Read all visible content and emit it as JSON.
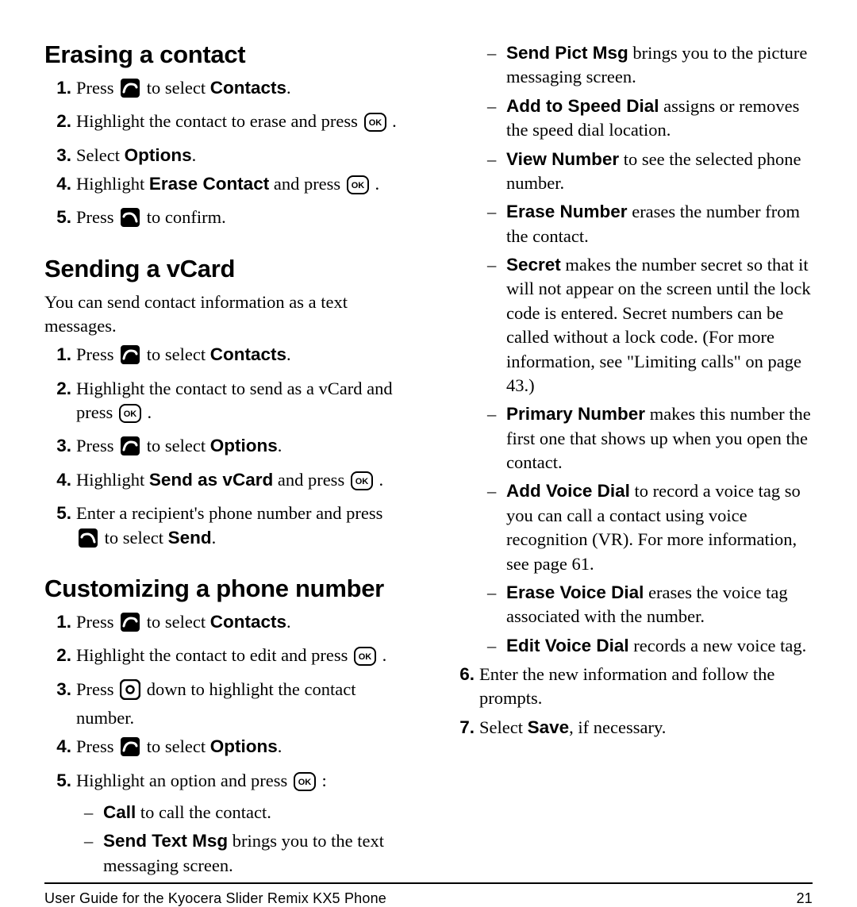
{
  "footer": {
    "text": "User Guide for the Kyocera Slider Remix KX5 Phone",
    "page": "21"
  },
  "sections": {
    "erase": {
      "heading": "Erasing a contact",
      "steps": [
        {
          "pre": "Press ",
          "icon": "soft-left",
          "post": " to select ",
          "bold": "Contacts",
          "tail": "."
        },
        {
          "pre": "Highlight the contact to erase and press ",
          "icon": "ok",
          "post": " .",
          "bold": "",
          "tail": ""
        },
        {
          "pre": "Select ",
          "bold": "Options",
          "tail": "."
        },
        {
          "pre": "Highlight ",
          "bold": "Erase Contact",
          "post": " and press ",
          "icon": "ok",
          "tail": " ."
        },
        {
          "pre": "Press ",
          "icon": "soft-right",
          "post": " to confirm.",
          "bold": "",
          "tail": ""
        }
      ]
    },
    "vcard": {
      "heading": "Sending a vCard",
      "intro": "You can send contact information as a text messages.",
      "steps": [
        {
          "pre": "Press ",
          "icon": "soft-left",
          "post": " to select ",
          "bold": "Contacts",
          "tail": "."
        },
        {
          "pre": "Highlight the contact to send as a vCard and press ",
          "icon": "ok",
          "post": " .",
          "bold": "",
          "tail": ""
        },
        {
          "pre": "Press ",
          "icon": "soft-left",
          "post": " to select ",
          "bold": "Options",
          "tail": "."
        },
        {
          "pre": "Highlight ",
          "bold": "Send as vCard",
          "post": " and press ",
          "icon": "ok",
          "tail": " ."
        },
        {
          "pre": "Enter a recipient's phone number and press ",
          "icon": "soft-right",
          "post": " to select ",
          "bold": "Send",
          "tail": "."
        }
      ]
    },
    "custom": {
      "heading": "Customizing a phone number",
      "steps_a": [
        {
          "pre": "Press ",
          "icon": "soft-left",
          "post": " to select ",
          "bold": "Contacts",
          "tail": "."
        },
        {
          "pre": "Highlight the contact to edit and press ",
          "icon": "ok",
          "post": " .",
          "bold": "",
          "tail": ""
        },
        {
          "pre": "Press ",
          "icon": "nav",
          "post": " down to highlight the contact number.",
          "bold": "",
          "tail": ""
        },
        {
          "pre": "Press ",
          "icon": "soft-left",
          "post": " to select ",
          "bold": "Options",
          "tail": "."
        },
        {
          "pre": "Highlight an option and press ",
          "icon": "ok",
          "post": " :",
          "bold": "",
          "tail": ""
        }
      ],
      "options_a": [
        {
          "bold": "Call",
          "text": " to call the contact."
        },
        {
          "bold": "Send Text Msg",
          "text": " brings you to the text messaging screen."
        }
      ],
      "options_b": [
        {
          "bold": "Send Pict Msg",
          "text": " brings you to the picture messaging screen."
        },
        {
          "bold": "Add to Speed Dial",
          "text": " assigns or removes the speed dial location."
        },
        {
          "bold": "View Number",
          "text": " to see the selected phone number."
        },
        {
          "bold": "Erase Number",
          "text": " erases the number from the contact."
        },
        {
          "bold": "Secret",
          "text": " makes the number secret so that it will not appear on the screen until the lock code is entered. Secret numbers can be called without a lock code. (For more information, see \"Limiting calls\" on page 43.)"
        },
        {
          "bold": "Primary Number",
          "text": " makes this number the first one that shows up when you open the contact."
        },
        {
          "bold": "Add Voice Dial",
          "text": " to record a voice tag so you can call a contact using voice recognition (VR). For more information, see page 61."
        },
        {
          "bold": "Erase Voice Dial",
          "text": " erases the voice tag associated with the number."
        },
        {
          "bold": "Edit Voice Dial",
          "text": " records a new voice tag."
        }
      ],
      "steps_b": [
        {
          "pre": "Enter the new information and follow the prompts."
        },
        {
          "pre": "Select ",
          "bold": "Save",
          "tail": ", if necessary."
        }
      ]
    }
  }
}
